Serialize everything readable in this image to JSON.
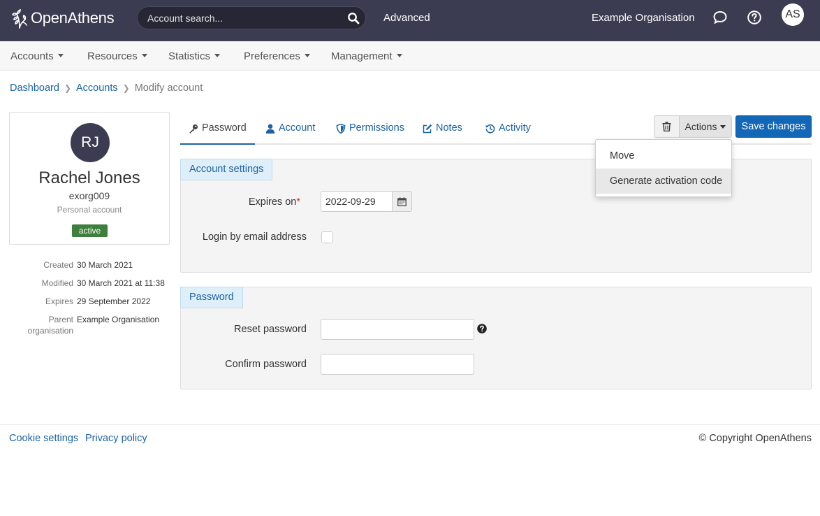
{
  "header": {
    "logo_text": "OpenAthens",
    "search_placeholder": "Account search...",
    "advanced_label": "Advanced",
    "organisation": "Example Organisation",
    "user_initials": "AS"
  },
  "nav": {
    "items": [
      {
        "label": "Accounts"
      },
      {
        "label": "Resources"
      },
      {
        "label": "Statistics"
      },
      {
        "label": "Preferences"
      },
      {
        "label": "Management"
      }
    ]
  },
  "breadcrumb": {
    "items": [
      "Dashboard",
      "Accounts"
    ],
    "current": "Modify account"
  },
  "profile": {
    "initials": "RJ",
    "name": "Rachel Jones",
    "username": "exorg009",
    "account_type": "Personal account",
    "status": "active",
    "meta": {
      "created_label": "Created",
      "created_value": "30 March 2021",
      "modified_label": "Modified",
      "modified_value": "30 March 2021 at 11:38",
      "expires_label": "Expires",
      "expires_value": "29 September 2022",
      "parent_label_1": "Parent",
      "parent_label_2": "organisation",
      "parent_value": "Example Organisation"
    }
  },
  "tabs": [
    {
      "label": "Password",
      "icon": "key-icon",
      "active": true
    },
    {
      "label": "Account",
      "icon": "user-icon"
    },
    {
      "label": "Permissions",
      "icon": "shield-icon"
    },
    {
      "label": "Notes",
      "icon": "edit-icon"
    },
    {
      "label": "Activity",
      "icon": "history-icon"
    }
  ],
  "toolbar": {
    "actions_label": "Actions",
    "save_label": "Save changes",
    "dropdown": [
      "Move",
      "Generate activation code"
    ]
  },
  "account_settings": {
    "title": "Account settings",
    "expires_label": "Expires on",
    "required_mark": "*",
    "expires_value": "2022-09-29",
    "login_email_label": "Login by email address",
    "login_email_checked": false
  },
  "password": {
    "title": "Password",
    "reset_label": "Reset password",
    "confirm_label": "Confirm password",
    "reset_value": "",
    "confirm_value": ""
  },
  "footer": {
    "cookie_label": "Cookie settings",
    "privacy_label": "Privacy policy",
    "copyright": "© Copyright OpenAthens"
  },
  "colors": {
    "topbar": "#3b3b51",
    "link": "#1b63a6",
    "primary_button": "#1267b7",
    "status_active": "#3d7f3b",
    "panel_header": "#dfeff9"
  }
}
